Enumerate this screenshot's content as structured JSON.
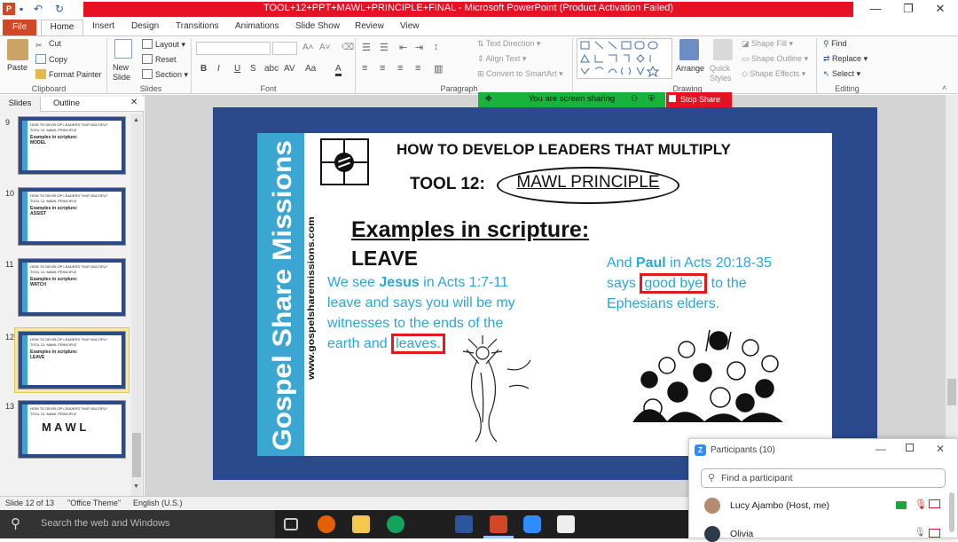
{
  "window": {
    "title": "TOOL+12+PPT+MAWL+PRINCIPLE+FINAL - Microsoft PowerPoint (Product Activation Failed)",
    "minimize": "—",
    "restore": "❐",
    "close": "✕"
  },
  "tabs": [
    "File",
    "Home",
    "Insert",
    "Design",
    "Transitions",
    "Animations",
    "Slide Show",
    "Review",
    "View"
  ],
  "ribbon": {
    "clipboard": {
      "paste": "Paste",
      "cut": "Cut",
      "copy": "Copy",
      "format_painter": "Format Painter",
      "group": "Clipboard"
    },
    "slides": {
      "new_slide": "New Slide",
      "layout": "Layout",
      "reset": "Reset",
      "section": "Section",
      "group": "Slides"
    },
    "font": {
      "group": "Font",
      "bold": "B",
      "italic": "I",
      "underline": "U",
      "strike": "S",
      "shadow": "abc",
      "spacing": "AV",
      "case": "Aa",
      "color": "A"
    },
    "paragraph": {
      "group": "Paragraph",
      "text_direction": "Text Direction",
      "align_text": "Align Text",
      "smartart": "Convert to SmartArt"
    },
    "drawing": {
      "group": "Drawing",
      "arrange": "Arrange",
      "quick_styles": "Quick Styles",
      "shape_fill": "Shape Fill",
      "shape_outline": "Shape Outline",
      "shape_effects": "Shape Effects"
    },
    "editing": {
      "group": "Editing",
      "find": "Find",
      "replace": "Replace",
      "select": "Select"
    }
  },
  "share_bar": {
    "status": "You are screen sharing",
    "stop": "Stop Share"
  },
  "panel": {
    "tabs": [
      "Slides",
      "Outline"
    ],
    "close": "✕",
    "thumbnails": [
      {
        "num": "9",
        "line1": "HOW TO DEVELOP LEADERS THAT MULTIPLY",
        "line2": "TOOL 12: MAWL PRINCIPLE",
        "line3": "Examples in scripture:",
        "line4": "MODEL"
      },
      {
        "num": "10",
        "line1": "HOW TO DEVELOP LEADERS THAT MULTIPLY",
        "line2": "TOOL 12: MAWL PRINCIPLE",
        "line3": "Examples in scripture:",
        "line4": "ASSIST"
      },
      {
        "num": "11",
        "line1": "HOW TO DEVELOP LEADERS THAT MULTIPLY",
        "line2": "TOOL 12: MAWL PRINCIPLE",
        "line3": "Examples in scripture:",
        "line4": "WATCH"
      },
      {
        "num": "12",
        "line1": "HOW TO DEVELOP LEADERS THAT MULTIPLY",
        "line2": "TOOL 12: MAWL PRINCIPLE",
        "line3": "Examples in scripture:",
        "line4": "LEAVE"
      },
      {
        "num": "13",
        "line1": "HOW TO DEVELOP LEADERS THAT MULTIPLY",
        "line2": "TOOL 12: MAWL PRINCIPLE",
        "line3": "M A W L",
        "line4": ""
      }
    ]
  },
  "slide": {
    "brand": "Gospel Share Missions",
    "url": "www.gospelsharemissions.com",
    "heading": "HOW TO DEVELOP LEADERS THAT MULTIPLY",
    "tool": "TOOL 12:",
    "principle": "MAWL PRINCIPLE",
    "examples_title": "Examples in scripture:",
    "step": "LEAVE",
    "left_text": {
      "p1": "We see ",
      "jesus": "Jesus",
      "p2": " in Acts 1:7-11",
      "line2": "leave and says you will be my",
      "line3": "witnesses to the ends of the",
      "line4a": "earth and ",
      "leaves": "leaves."
    },
    "right_text": {
      "p1": "And ",
      "paul": "Paul",
      "p2": " in Acts 20:18-35",
      "p3": "says ",
      "goodbye": "good bye",
      "p4": " to the",
      "line3": "Ephesians elders."
    }
  },
  "status": {
    "slide": "Slide 12 of 13",
    "theme": "\"Office Theme\"",
    "language": "English (U.S.)"
  },
  "taskbar": {
    "search": "Search the web and Windows"
  },
  "zoom": {
    "title": "Participants (10)",
    "search_placeholder": "Find a participant",
    "participants": [
      {
        "name": "Lucy Ajambo (Host, me)"
      },
      {
        "name": "Olivia"
      }
    ]
  },
  "colors": {
    "accent_blue": "#3ba6d2",
    "slide_navy": "#2a4a8c",
    "highlight_red": "#e01b1b",
    "ppt_orange": "#d24726",
    "share_green": "#18b33d"
  }
}
